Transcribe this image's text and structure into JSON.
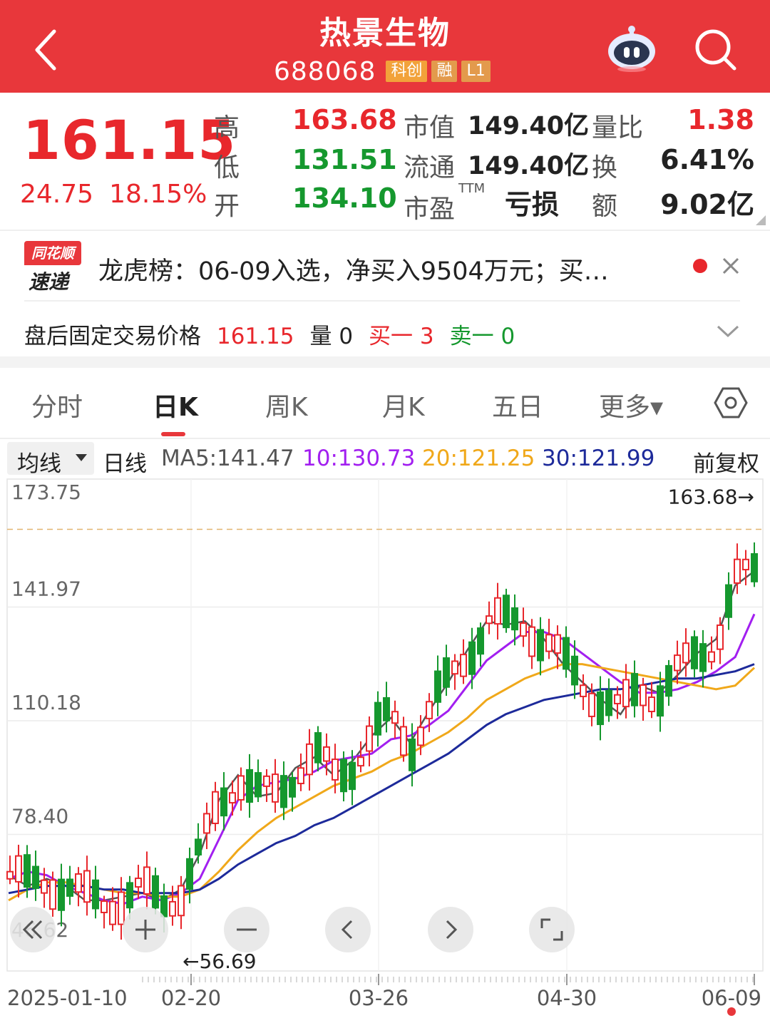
{
  "header": {
    "title": "热景生物",
    "code": "688068",
    "tags": [
      "科创",
      "融",
      "L1"
    ]
  },
  "quote": {
    "price": "161.15",
    "change": "24.75",
    "change_pct": "18.15%",
    "high_label": "高",
    "high": "163.68",
    "low_label": "低",
    "low": "131.51",
    "open_label": "开",
    "open": "134.10",
    "mktcap_label": "市值",
    "mktcap": "149.40亿",
    "float_label": "流通",
    "float": "149.40亿",
    "pe_label": "市盈",
    "pe_sup": "TTM",
    "pe": "亏损",
    "volratio_label": "量比",
    "volratio": "1.38",
    "turnover_label": "换",
    "turnover": "6.41%",
    "amount_label": "额",
    "amount": "9.02亿"
  },
  "news": {
    "logo_top": "同花顺",
    "logo_bottom": "速递",
    "text": "龙虎榜：06-09入选，净买入9504万元；买…"
  },
  "after_hours": {
    "label": "盘后固定交易价格",
    "price": "161.15",
    "volume": "量 0",
    "buy1": "买一 3",
    "sell1": "卖一 0"
  },
  "tabs": [
    "分时",
    "日K",
    "周K",
    "月K",
    "五日",
    "更多▾"
  ],
  "active_tab": "日K",
  "ma_bar": {
    "selector": "均线",
    "period": "日线",
    "ma5": "MA5:141.47",
    "ma10": "10:130.73",
    "ma20": "20:121.25",
    "ma30": "30:121.99",
    "adjust": "前复权"
  },
  "colors": {
    "brand_red": "#e8373b",
    "up": "#e8272c",
    "down": "#15982e",
    "ma5": "#555555",
    "ma10": "#a21ff0",
    "ma20": "#f0a81a",
    "ma30": "#1d2a9a"
  },
  "chart_data": {
    "type": "candlestick",
    "title": "",
    "y_ticks": [
      "173.75",
      "141.97",
      "110.18",
      "78.40",
      "46.62"
    ],
    "ylim": [
      46.62,
      173.75
    ],
    "x_ticks": [
      "2025-01-10",
      "02-20",
      "03-26",
      "04-30",
      "06-09"
    ],
    "max_label": "163.68→",
    "min_label": "←56.69",
    "grid": true,
    "series": [
      {
        "name": "MA5",
        "values": [
          67,
          64,
          66,
          64,
          60,
          60,
          61,
          62,
          60,
          63,
          73,
          88,
          95,
          89,
          90,
          97,
          100,
          95,
          99,
          106,
          111,
          104,
          113,
          121,
          130,
          138,
          137,
          138,
          133,
          126,
          121,
          116,
          112,
          120,
          118,
          123,
          129,
          133,
          148,
          152
        ]
      },
      {
        "name": "10",
        "values": [
          66,
          68,
          67,
          64,
          62,
          60,
          59,
          61,
          60,
          62,
          66,
          77,
          88,
          92,
          93,
          94,
          96,
          99,
          100,
          101,
          105,
          106,
          109,
          113,
          120,
          127,
          131,
          135,
          135,
          133,
          129,
          125,
          121,
          118,
          118,
          119,
          121,
          124,
          128,
          140
        ]
      },
      {
        "name": "20",
        "values": [
          60,
          63,
          65,
          65,
          64,
          63,
          62,
          62,
          61,
          61,
          63,
          68,
          74,
          79,
          83,
          86,
          89,
          92,
          94,
          96,
          99,
          101,
          104,
          107,
          111,
          116,
          119,
          122,
          124,
          126,
          126,
          125,
          124,
          123,
          122,
          121,
          120,
          119,
          120,
          125
        ]
      },
      {
        "name": "30",
        "values": [
          62,
          63,
          64,
          64,
          64,
          63,
          63,
          62,
          62,
          62,
          63,
          66,
          70,
          73,
          76,
          78,
          81,
          83,
          86,
          89,
          92,
          95,
          98,
          101,
          105,
          109,
          112,
          114,
          116,
          117,
          118,
          119,
          119,
          120,
          121,
          122,
          122,
          123,
          124,
          126
        ]
      }
    ]
  }
}
